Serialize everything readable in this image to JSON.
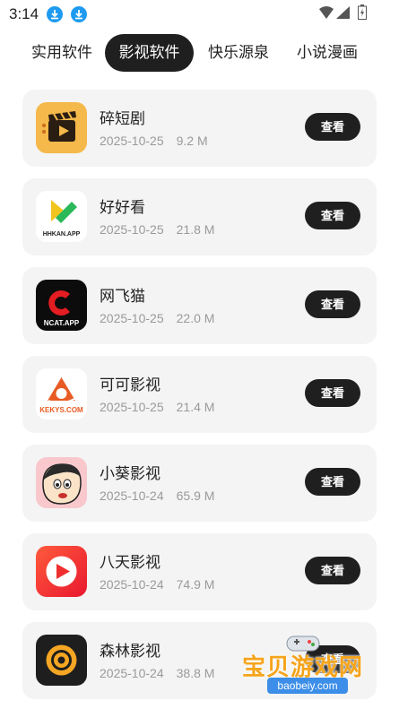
{
  "status_bar": {
    "time": "3:14"
  },
  "tabs": [
    {
      "label": "实用软件",
      "active": false
    },
    {
      "label": "影视软件",
      "active": true
    },
    {
      "label": "快乐源泉",
      "active": false
    },
    {
      "label": "小说漫画",
      "active": false
    }
  ],
  "apps": [
    {
      "name": "碎短剧",
      "date": "2025-10-25",
      "size": "9.2 M",
      "button": "查看",
      "icon": "clapperboard-play-icon"
    },
    {
      "name": "好好看",
      "date": "2025-10-25",
      "size": "21.8 M",
      "button": "查看",
      "icon": "hhkan-logo-icon",
      "icon_text": "HHKAN.APP"
    },
    {
      "name": "网飞猫",
      "date": "2025-10-25",
      "size": "22.0 M",
      "button": "查看",
      "icon": "ncat-logo-icon",
      "icon_text": "NCAT.APP"
    },
    {
      "name": "可可影视",
      "date": "2025-10-25",
      "size": "21.4 M",
      "button": "查看",
      "icon": "kekys-logo-icon",
      "icon_text": "KEKYS.COM"
    },
    {
      "name": "小葵影视",
      "date": "2025-10-24",
      "size": "65.9 M",
      "button": "查看",
      "icon": "cartoon-boy-icon"
    },
    {
      "name": "八天影视",
      "date": "2025-10-24",
      "size": "74.9 M",
      "button": "查看",
      "icon": "red-play-icon"
    },
    {
      "name": "森林影视",
      "date": "2025-10-24",
      "size": "38.8 M",
      "button": "查看",
      "icon": "orange-circle-icon"
    }
  ],
  "watermark": {
    "text": "宝贝游戏网",
    "url": "baobeiy.com"
  }
}
